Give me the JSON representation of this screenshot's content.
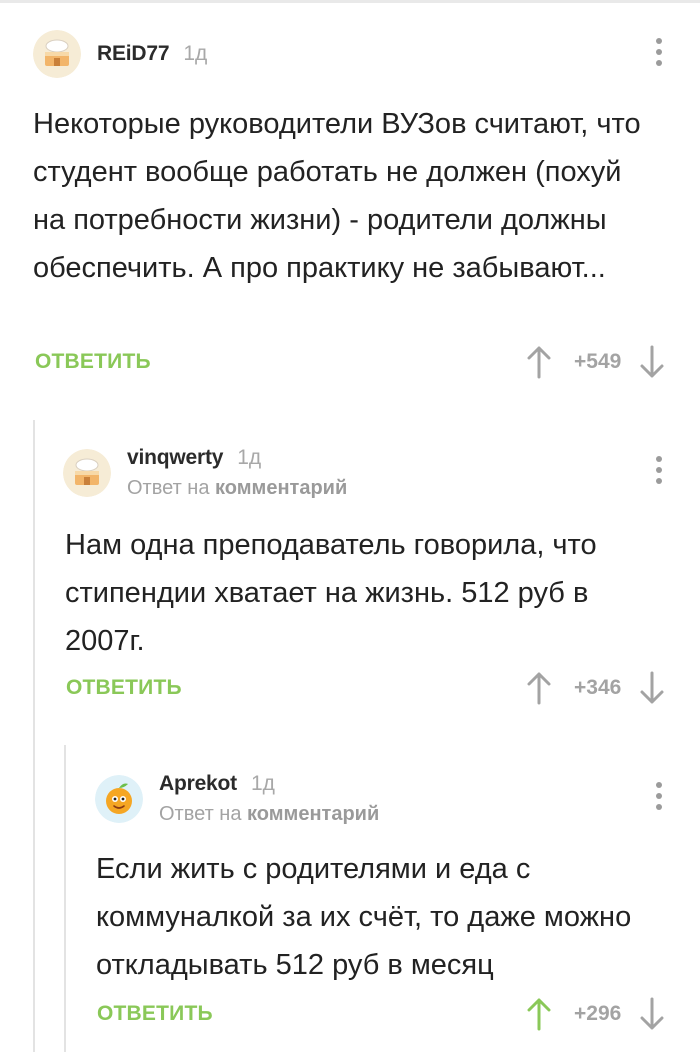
{
  "comments": [
    {
      "username": "REiD77",
      "age": "1д",
      "text": "Некоторые руководители ВУЗов считают, что студент вообще работать не должен (похуй на потребности жизни) - родители должны обеспечить. А про практику не забывают...",
      "reply_label": "ОТВЕТИТЬ",
      "score": "+549",
      "avatar_icon": "cake-house-icon"
    },
    {
      "username": "vinqwerty",
      "age": "1д",
      "reply_prefix": "Ответ на",
      "reply_target": "комментарий",
      "text": "Нам одна преподаватель говорила, что стипендии хватает на жизнь. 512 руб в 2007г.",
      "reply_label": "ОТВЕТИТЬ",
      "score": "+346",
      "avatar_icon": "cake-house-icon"
    },
    {
      "username": "Aprekot",
      "age": "1д",
      "reply_prefix": "Ответ на",
      "reply_target": "комментарий",
      "text": "Если жить с родителями и еда с коммуналкой за их счёт, то даже можно откладывать 512 руб в месяц",
      "reply_label": "ОТВЕТИТЬ",
      "score": "+296",
      "upvoted": true,
      "avatar_icon": "apricot-character-icon"
    }
  ],
  "colors": {
    "accent_green": "#8ac858",
    "muted_gray": "#a3a3a3",
    "thread_line": "#e3e3e3"
  }
}
